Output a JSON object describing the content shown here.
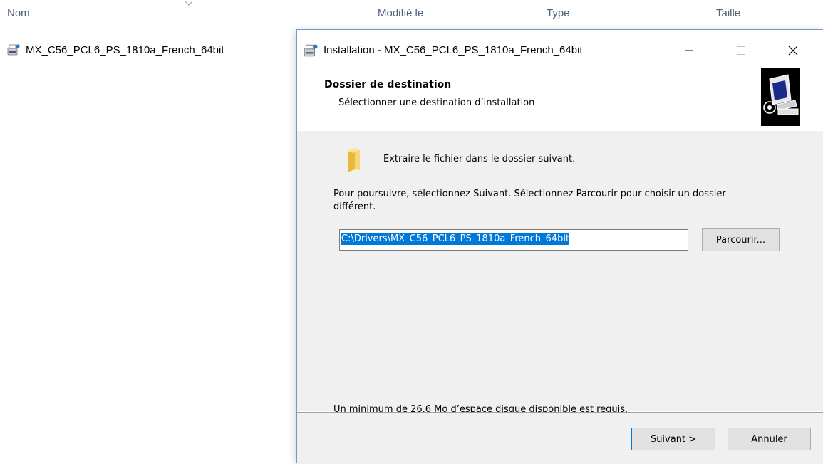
{
  "explorer": {
    "columns": {
      "name": "Nom",
      "modified": "Modifié le",
      "type": "Type",
      "size": "Taille"
    },
    "files": [
      {
        "name": "MX_C56_PCL6_PS_1810a_French_64bit",
        "icon": "installer-icon"
      }
    ]
  },
  "dialog": {
    "title": "Installation - MX_C56_PCL6_PS_1810a_French_64bit",
    "header_title": "Dossier de destination",
    "header_subtitle": "Sélectionner une destination d’installation",
    "extract_text": "Extraire le fichier dans le dossier suivant.",
    "instructions": "Pour poursuivre, sélectionnez Suivant.  Sélectionnez Parcourir pour choisir un dossier différent.",
    "path_value": "C:\\Drivers\\MX_C56_PCL6_PS_1810a_French_64bit",
    "browse_label": "Parcourir...",
    "disk_requirement": "Un minimum de 26,6 Mo d’espace disque disponible est requis.",
    "next_label": "Suivant >",
    "cancel_label": "Annuler"
  },
  "colors": {
    "accent": "#0078d7",
    "body_bg": "#f0f0f0",
    "header_text": "#4c607a"
  }
}
